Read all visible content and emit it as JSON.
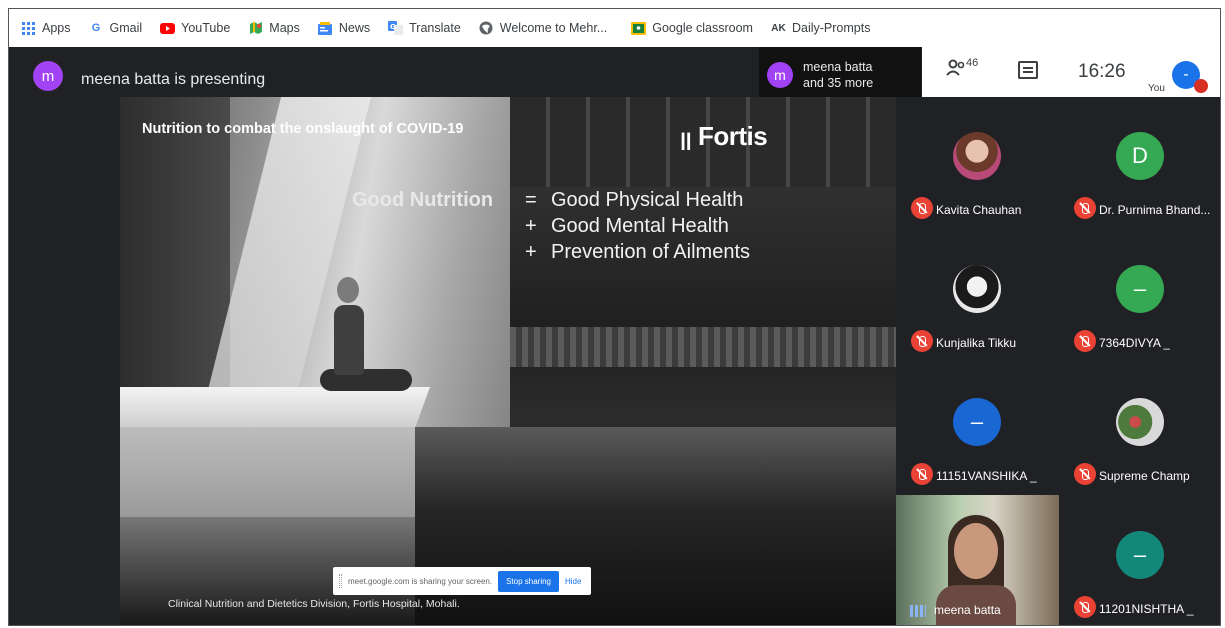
{
  "bookmarks": [
    {
      "label": "Apps",
      "icon": "apps-grid-icon"
    },
    {
      "label": "Gmail",
      "icon": "google-g-icon"
    },
    {
      "label": "YouTube",
      "icon": "youtube-icon"
    },
    {
      "label": "Maps",
      "icon": "maps-icon"
    },
    {
      "label": "News",
      "icon": "news-icon"
    },
    {
      "label": "Translate",
      "icon": "translate-icon"
    },
    {
      "label": "Welcome to Mehr...",
      "icon": "globe-icon"
    },
    {
      "label": "Google classroom",
      "icon": "classroom-icon"
    },
    {
      "label": "Daily-Prompts",
      "icon": "ak-icon"
    }
  ],
  "topbar": {
    "presenter_initial": "m",
    "presenter_text": "meena batta is presenting",
    "others_initial": "m",
    "others_line1": "meena batta",
    "others_line2": "and 35 more",
    "people_count": "46",
    "time": "16:26",
    "you_label": "You",
    "you_initial": "-"
  },
  "slide": {
    "title": "Nutrition to combat the onslaught of COVID-19",
    "brand": "Fortis",
    "headline": "Good Nutrition",
    "equations": [
      {
        "op": "=",
        "text": "Good Physical Health"
      },
      {
        "op": "+",
        "text": "Good Mental Health"
      },
      {
        "op": "+",
        "text": "Prevention of Ailments"
      }
    ],
    "footer": "Clinical Nutrition and Dietetics Division, Fortis Hospital, Mohali."
  },
  "share_banner": {
    "message": "meet.google.com is sharing your screen.",
    "stop_label": "Stop sharing",
    "hide_label": "Hide"
  },
  "participants": [
    {
      "name": "Kavita Chauhan",
      "initial": "",
      "color": "",
      "photo": "photo-a"
    },
    {
      "name": "Dr. Purnima Bhand...",
      "initial": "D",
      "color": "#34a853",
      "photo": ""
    },
    {
      "name": "Kunjalika Tikku",
      "initial": "",
      "color": "",
      "photo": "photo-b"
    },
    {
      "name": "7364DIVYA _",
      "initial": "–",
      "color": "#34a853",
      "photo": ""
    },
    {
      "name": "11151VANSHIKA _",
      "initial": "–",
      "color": "#1967d2",
      "photo": ""
    },
    {
      "name": "Supreme Champ",
      "initial": "",
      "color": "",
      "photo": "photo-c"
    },
    {
      "name": "11201NISHTHA _",
      "initial": "–",
      "color": "#12877a",
      "photo": ""
    }
  ],
  "self_view": {
    "name": "meena batta"
  }
}
